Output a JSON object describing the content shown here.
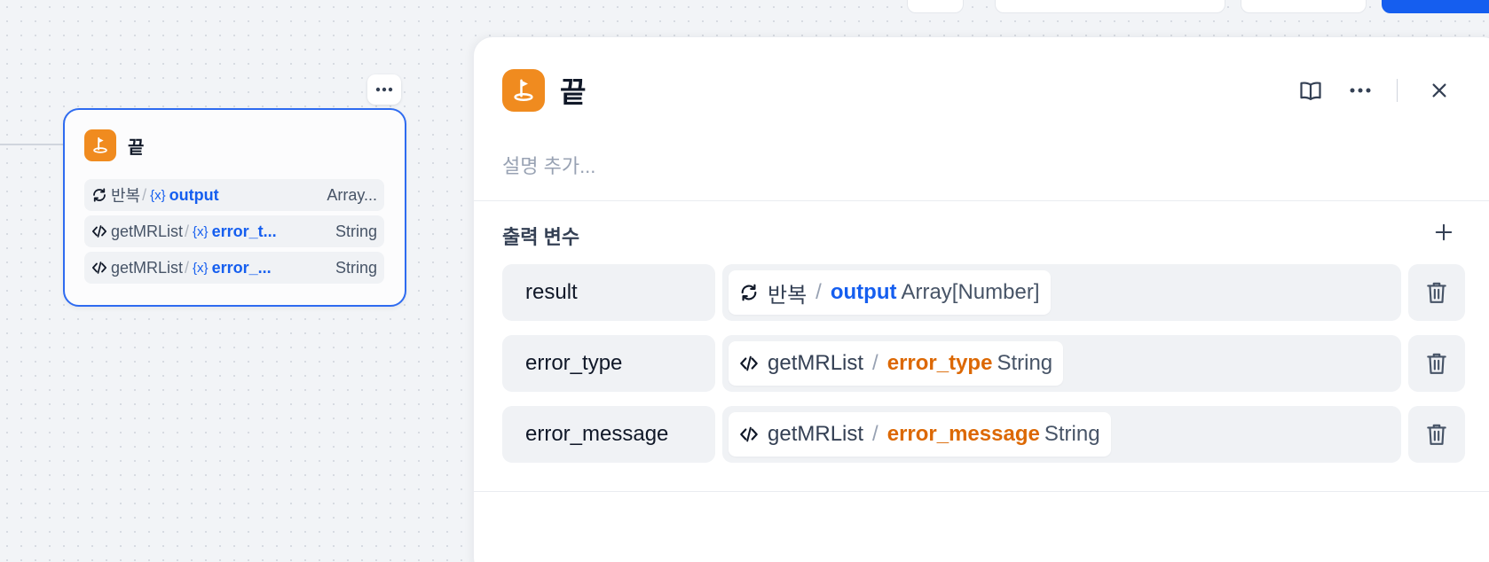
{
  "node": {
    "title": "끝",
    "rows": [
      {
        "source": "반복",
        "source_icon": "loop-icon",
        "variable": "output",
        "type": "Array..."
      },
      {
        "source": "getMRList",
        "source_icon": "code-icon",
        "variable": "error_t...",
        "type": "String"
      },
      {
        "source": "getMRList",
        "source_icon": "code-icon",
        "variable": "error_...",
        "type": "String"
      }
    ]
  },
  "panel": {
    "title": "끝",
    "description_placeholder": "설명 추가...",
    "section_title": "출력 변수",
    "outputs": [
      {
        "name": "result",
        "source": "반복",
        "source_icon": "loop-icon",
        "variable": "output",
        "type": "Array[Number]",
        "variable_color": "#155eef"
      },
      {
        "name": "error_type",
        "source": "getMRList",
        "source_icon": "code-icon",
        "variable": "error_type",
        "type": "String",
        "variable_color": "#dc6803"
      },
      {
        "name": "error_message",
        "source": "getMRList",
        "source_icon": "code-icon",
        "variable": "error_message",
        "type": "String",
        "variable_color": "#dc6803"
      }
    ]
  },
  "sep": "/",
  "var_glyph": "{x}",
  "colors": {
    "accent": "#155eef",
    "end_node": "#f08b1f",
    "variable_orange": "#dc6803"
  }
}
